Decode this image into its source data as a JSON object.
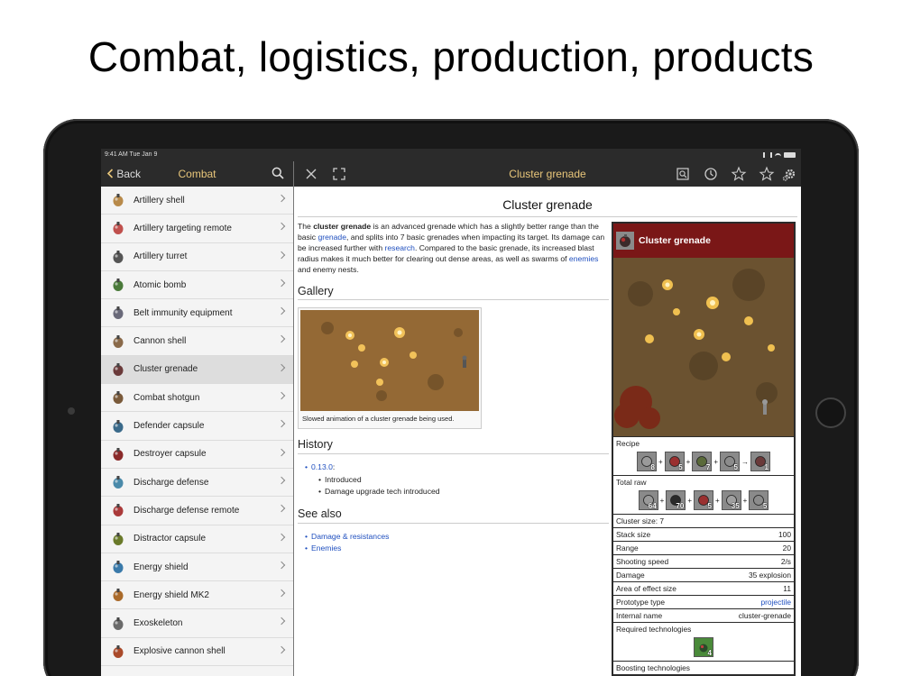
{
  "headline": "Combat, logistics, production, products",
  "status_bar": {
    "time": "9:41 AM  Tue Jan 9"
  },
  "left_nav": {
    "back_label": "Back",
    "title": "Combat"
  },
  "list_items": [
    {
      "label": "Artillery shell",
      "icon": "artillery-shell-icon",
      "color": "#b88a4a"
    },
    {
      "label": "Artillery targeting remote",
      "icon": "artillery-remote-icon",
      "color": "#c0504d"
    },
    {
      "label": "Artillery turret",
      "icon": "artillery-turret-icon",
      "color": "#555555"
    },
    {
      "label": "Atomic bomb",
      "icon": "atomic-bomb-icon",
      "color": "#4a7a3a"
    },
    {
      "label": "Belt immunity equipment",
      "icon": "belt-immunity-icon",
      "color": "#6a6a7a"
    },
    {
      "label": "Cannon shell",
      "icon": "cannon-shell-icon",
      "color": "#8a6a4a"
    },
    {
      "label": "Cluster grenade",
      "icon": "cluster-grenade-icon",
      "color": "#6a3a3a"
    },
    {
      "label": "Combat shotgun",
      "icon": "combat-shotgun-icon",
      "color": "#7a5a3a"
    },
    {
      "label": "Defender capsule",
      "icon": "defender-capsule-icon",
      "color": "#3a6a8a"
    },
    {
      "label": "Destroyer capsule",
      "icon": "destroyer-capsule-icon",
      "color": "#8a2a2a"
    },
    {
      "label": "Discharge defense",
      "icon": "discharge-defense-icon",
      "color": "#4a8aaa"
    },
    {
      "label": "Discharge defense remote",
      "icon": "discharge-remote-icon",
      "color": "#aa3a3a"
    },
    {
      "label": "Distractor capsule",
      "icon": "distractor-capsule-icon",
      "color": "#6a7a2a"
    },
    {
      "label": "Energy shield",
      "icon": "energy-shield-icon",
      "color": "#3a7aaa"
    },
    {
      "label": "Energy shield MK2",
      "icon": "energy-shield-mk2-icon",
      "color": "#aa6a2a"
    },
    {
      "label": "Exoskeleton",
      "icon": "exoskeleton-icon",
      "color": "#6a6a6a"
    },
    {
      "label": "Explosive cannon shell",
      "icon": "explosive-cannon-shell-icon",
      "color": "#aa4a2a"
    }
  ],
  "selected_index": 6,
  "right_nav": {
    "title": "Cluster grenade"
  },
  "article": {
    "title": "Cluster grenade",
    "intro": {
      "p1": "The ",
      "bold": "cluster grenade",
      "p2": " is an advanced grenade which has a slightly better range than the basic ",
      "link1": "grenade",
      "p3": ", and splits into 7 basic grenades when impacting its target. Its damage can be increased further with ",
      "link2": "research",
      "p4": ". Compared to the basic grenade, its increased blast radius makes it much better for clearing out dense areas, as well as swarms of ",
      "link3": "enemies",
      "p5": " and enemy nests."
    },
    "gallery_heading": "Gallery",
    "gallery_caption": "Slowed animation of a cluster grenade being used.",
    "history_heading": "History",
    "history_version": "0.13.0",
    "history_colon": ":",
    "history_items": [
      "Introduced",
      "Damage upgrade tech introduced"
    ],
    "see_also_heading": "See also",
    "see_also": [
      "Damage & resistances",
      "Enemies"
    ]
  },
  "infobox": {
    "title": "Cluster grenade",
    "recipe_label": "Recipe",
    "recipe": [
      {
        "icon": "time-icon",
        "count": "8"
      },
      {
        "icon": "explosives-icon",
        "count": "5"
      },
      {
        "icon": "grenade-icon",
        "count": "7"
      },
      {
        "icon": "steel-plate-icon",
        "count": "5"
      },
      {
        "icon": "cluster-grenade-icon",
        "count": "1"
      }
    ],
    "total_raw_label": "Total raw",
    "total_raw": [
      {
        "icon": "time-icon",
        "count": "64"
      },
      {
        "icon": "coal-icon",
        "count": "70"
      },
      {
        "icon": "explosives-icon",
        "count": "5"
      },
      {
        "icon": "iron-plate-icon",
        "count": "35"
      },
      {
        "icon": "steel-plate-icon",
        "count": "5"
      }
    ],
    "cluster_size": "Cluster size: 7",
    "stats": [
      {
        "label": "Stack size",
        "value": "100"
      },
      {
        "label": "Range",
        "value": "20"
      },
      {
        "label": "Shooting speed",
        "value": "2/s"
      },
      {
        "label": "Damage",
        "value": "35 explosion"
      },
      {
        "label": "Area of effect size",
        "value": "11"
      },
      {
        "label": "Prototype type",
        "value": "projectile"
      },
      {
        "label": "Internal name",
        "value": "cluster-grenade"
      }
    ],
    "required_tech_label": "Required technologies",
    "required_tech_count": "4",
    "boosting_tech_label": "Boosting technologies"
  },
  "colors": {
    "nav_bg": "#2b2b2b",
    "nav_text": "#e8c67a",
    "infobox_header": "#7a1717",
    "link": "#1f4fbf"
  }
}
